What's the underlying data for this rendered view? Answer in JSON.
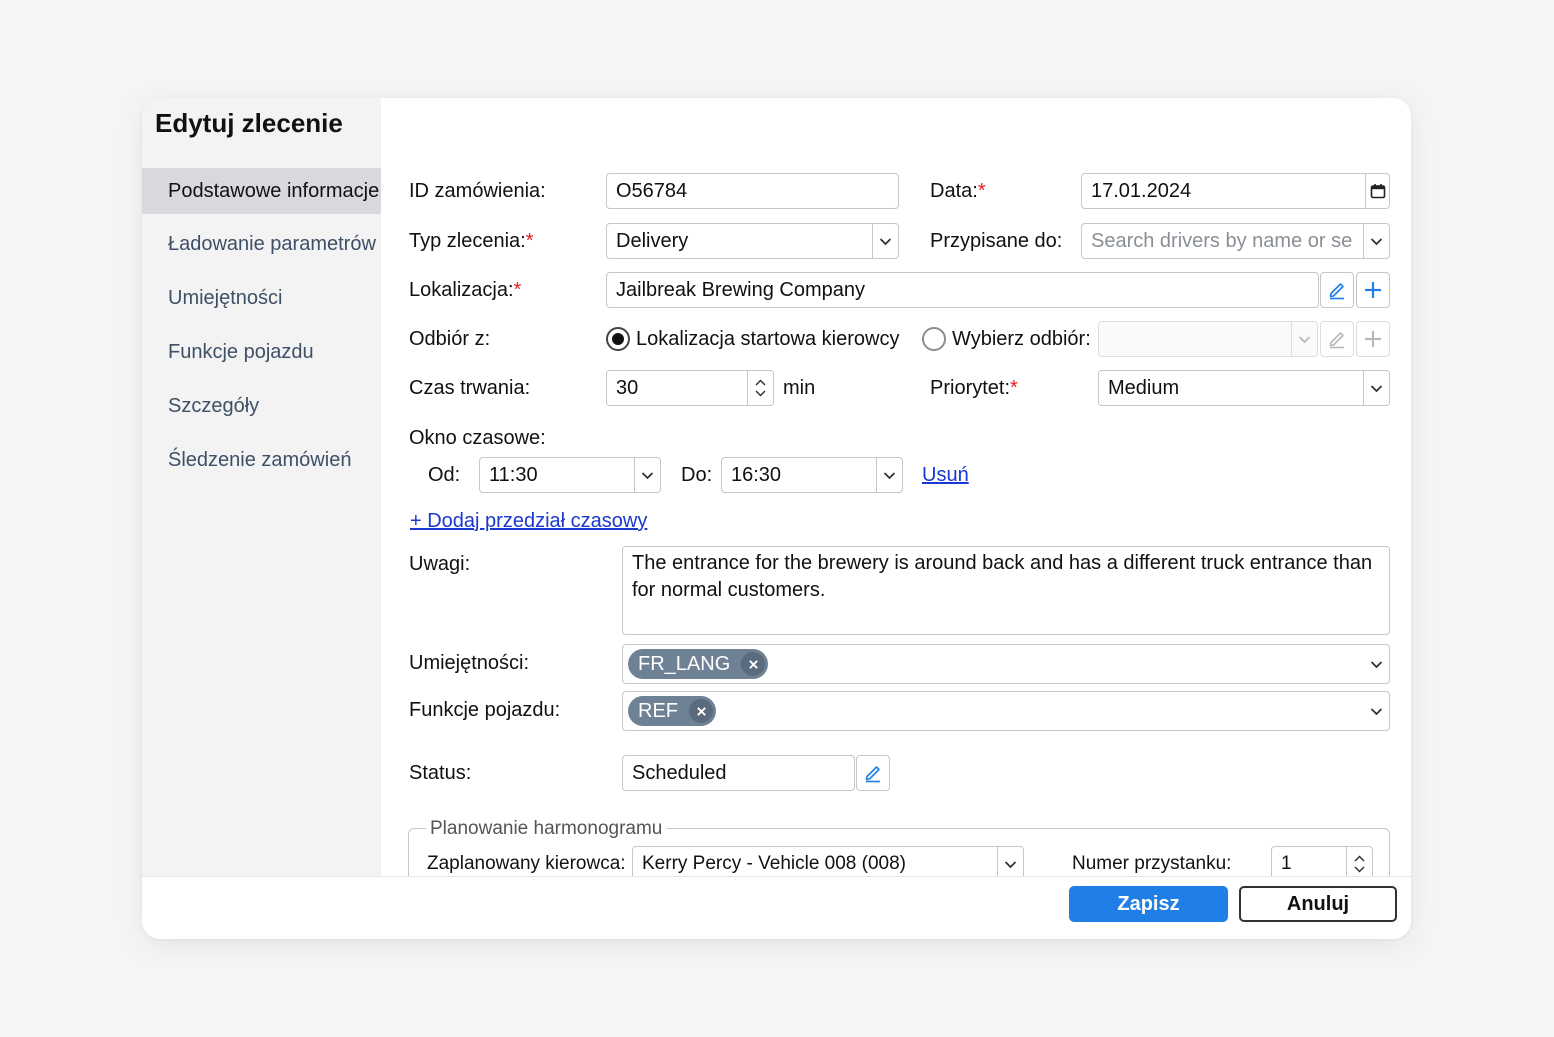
{
  "dialog": {
    "title": "Edytuj zlecenie"
  },
  "sidebar": {
    "items": [
      {
        "label": "Podstawowe informacje",
        "active": true
      },
      {
        "label": "Ładowanie parametrów"
      },
      {
        "label": "Umiejętności"
      },
      {
        "label": "Funkcje pojazdu"
      },
      {
        "label": "Szczegóły"
      },
      {
        "label": "Śledzenie zamówień"
      }
    ]
  },
  "form": {
    "order_id": {
      "label": "ID zamówienia:",
      "value": "O56784"
    },
    "date": {
      "label": "Data:",
      "required_mark": "*",
      "value": "17.01.2024",
      "icon": "calendar-icon"
    },
    "order_type": {
      "label": "Typ zlecenia:",
      "required_mark": "*",
      "value": "Delivery"
    },
    "assigned_to": {
      "label": "Przypisane do:",
      "placeholder": "Search drivers by name or se"
    },
    "location": {
      "label": "Lokalizacja:",
      "required_mark": "*",
      "value": "Jailbreak Brewing Company"
    },
    "pickup": {
      "label": "Odbiór z:",
      "option_driver_start": "Lokalizacja startowa kierowcy",
      "option_choose": "Wybierz odbiór:",
      "selected": "driver_start"
    },
    "duration": {
      "label": "Czas trwania:",
      "value": "30",
      "unit": "min"
    },
    "priority": {
      "label": "Priorytet:",
      "required_mark": "*",
      "value": "Medium"
    },
    "time_window": {
      "label": "Okno czasowe:",
      "from_label": "Od:",
      "from_value": "11:30",
      "to_label": "Do:",
      "to_value": "16:30",
      "remove_link": "Usuń",
      "add_link": "+ Dodaj przedział czasowy"
    },
    "notes": {
      "label": "Uwagi:",
      "value": "The entrance for the brewery is around back and has a different truck entrance than for normal customers."
    },
    "skills": {
      "label": "Umiejętności:",
      "tags": [
        "FR_LANG"
      ]
    },
    "vehicle_features": {
      "label": "Funkcje pojazdu:",
      "tags": [
        "REF"
      ]
    },
    "status": {
      "label": "Status:",
      "value": "Scheduled"
    },
    "scheduling": {
      "legend": "Planowanie harmonogramu",
      "driver_label": "Zaplanowany kierowca:",
      "driver_value": "Kerry Percy - Vehicle 008 (008)",
      "stop_number_label": "Numer przystanku:",
      "stop_number_value": "1"
    }
  },
  "footer": {
    "save_label": "Zapisz",
    "cancel_label": "Anuluj"
  },
  "colors": {
    "primary": "#1f7fe6",
    "link": "#1a38d0",
    "required": "#e02020",
    "tag": "#6f8194"
  }
}
